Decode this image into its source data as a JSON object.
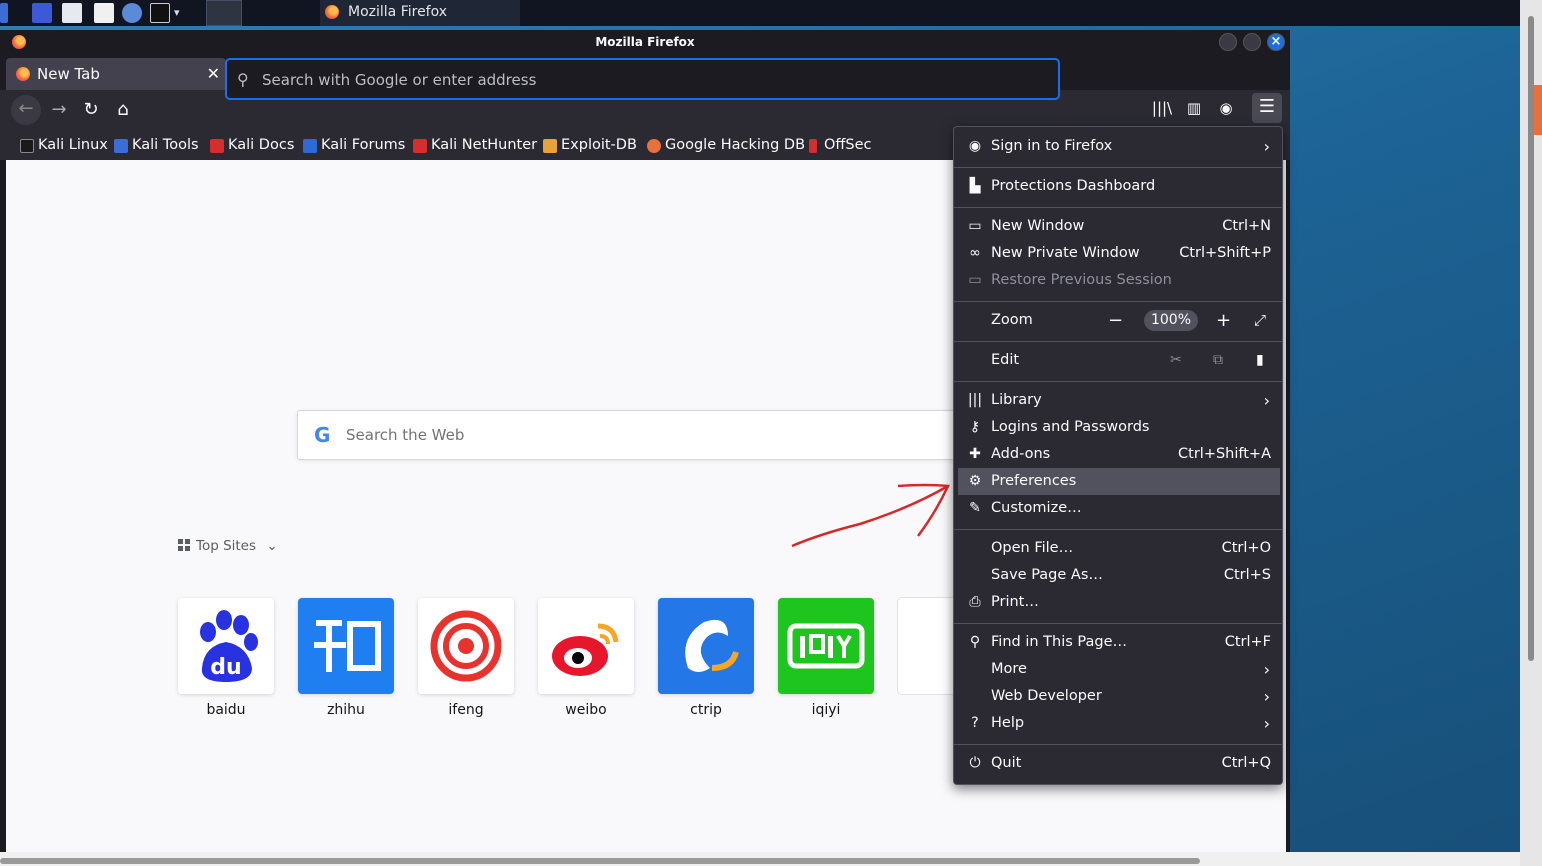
{
  "taskbar": {
    "window_title": "Mozilla Firefox"
  },
  "window": {
    "title": "Mozilla Firefox"
  },
  "tab": {
    "label": "New Tab"
  },
  "urlbar": {
    "placeholder": "Search with Google or enter address"
  },
  "bookmarks": [
    {
      "label": "Kali Linux",
      "color": "#1a1a1a"
    },
    {
      "label": "Kali Tools",
      "color": "#3c6cd8"
    },
    {
      "label": "Kali Docs",
      "color": "#d62d2d"
    },
    {
      "label": "Kali Forums",
      "color": "#2d6ad6"
    },
    {
      "label": "Kali NetHunter",
      "color": "#d62d2d"
    },
    {
      "label": "Exploit-DB",
      "color": "#e8a23a"
    },
    {
      "label": "Google Hacking DB",
      "color": "#e8703a"
    },
    {
      "label": "OffSec",
      "color": "#d62d2d"
    }
  ],
  "content": {
    "search_placeholder": "Search the Web",
    "top_sites_label": "Top Sites",
    "sites": [
      {
        "label": "baidu",
        "color": "#ffffff"
      },
      {
        "label": "zhihu",
        "color": "#1f7ff0"
      },
      {
        "label": "ifeng",
        "color": "#ffffff"
      },
      {
        "label": "weibo",
        "color": "#ffffff"
      },
      {
        "label": "ctrip",
        "color": "#2477e6"
      },
      {
        "label": "iqiyi",
        "color": "#1ec51e"
      }
    ]
  },
  "menu": {
    "sign_in": "Sign in to Firefox",
    "protections": "Protections Dashboard",
    "new_window": {
      "label": "New Window",
      "shortcut": "Ctrl+N"
    },
    "new_private": {
      "label": "New Private Window",
      "shortcut": "Ctrl+Shift+P"
    },
    "restore": "Restore Previous Session",
    "zoom": {
      "label": "Zoom",
      "value": "100%"
    },
    "edit": "Edit",
    "library": "Library",
    "logins": "Logins and Passwords",
    "addons": {
      "label": "Add-ons",
      "shortcut": "Ctrl+Shift+A"
    },
    "preferences": "Preferences",
    "customize": "Customize…",
    "open_file": {
      "label": "Open File…",
      "shortcut": "Ctrl+O"
    },
    "save_page": {
      "label": "Save Page As…",
      "shortcut": "Ctrl+S"
    },
    "print": "Print…",
    "find": {
      "label": "Find in This Page…",
      "shortcut": "Ctrl+F"
    },
    "more": "More",
    "web_dev": "Web Developer",
    "help": "Help",
    "quit": {
      "label": "Quit",
      "shortcut": "Ctrl+Q"
    }
  },
  "colors": {
    "accent": "#1b6ef0",
    "annotation_arrow": "#d42a2a"
  }
}
